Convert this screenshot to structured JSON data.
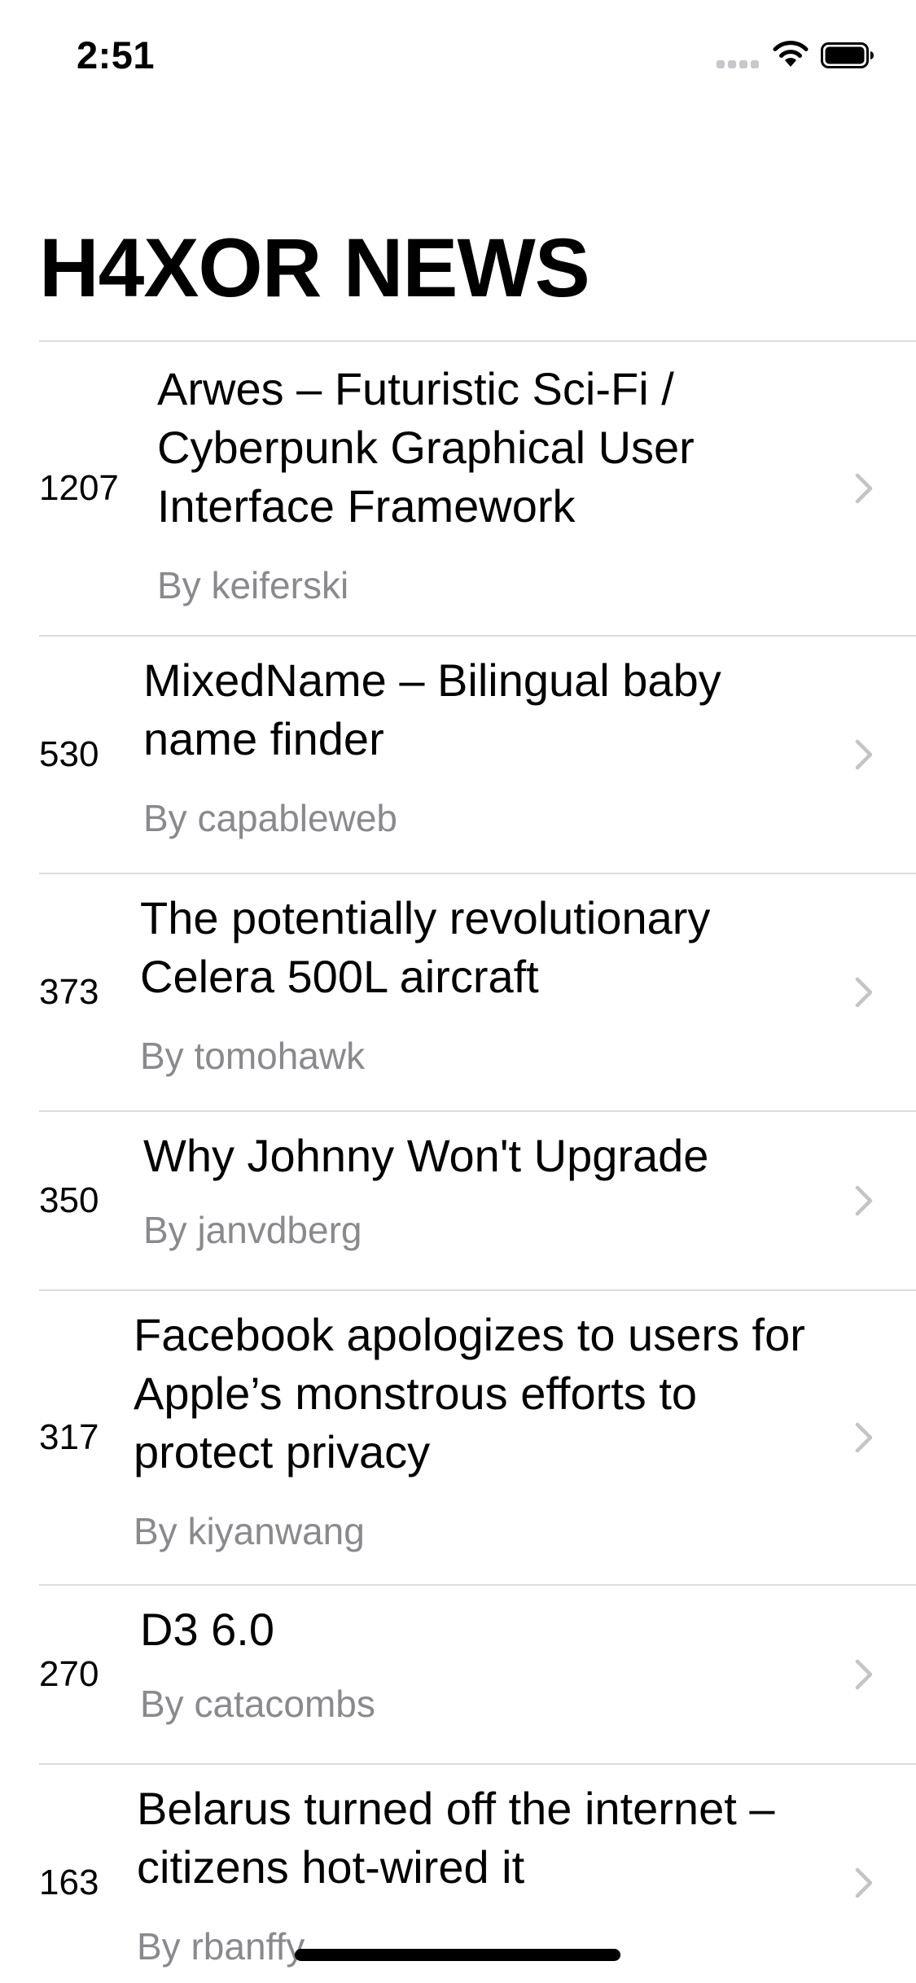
{
  "status_bar": {
    "time": "2:51"
  },
  "page": {
    "title": "H4XOR NEWS"
  },
  "stories": [
    {
      "points": "1207",
      "title_lines": [
        "Arwes – Futuristic Sci-Fi /",
        "Cyberpunk Graphical User",
        "Interface Framework"
      ],
      "author": "By keiferski"
    },
    {
      "points": "530",
      "title_lines": [
        "MixedName – Bilingual baby",
        "name finder"
      ],
      "author": "By capableweb"
    },
    {
      "points": "373",
      "title_lines": [
        "The potentially revolutionary",
        "Celera 500L aircraft"
      ],
      "author": "By tomohawk"
    },
    {
      "points": "350",
      "title_lines": [
        "Why Johnny Won't Upgrade"
      ],
      "author": "By janvdberg"
    },
    {
      "points": "317",
      "title_lines": [
        "Facebook apologizes to users for",
        "Apple’s monstrous efforts to",
        "protect privacy"
      ],
      "author": "By kiyanwang"
    },
    {
      "points": "270",
      "title_lines": [
        "D3 6.0"
      ],
      "author": "By catacombs"
    },
    {
      "points": "163",
      "title_lines": [
        "Belarus turned off the internet –",
        "citizens hot-wired it"
      ],
      "author": "By rbanffy"
    }
  ],
  "icons": {
    "row_accessory": "chevron-right-icon",
    "wifi": "wifi-icon",
    "battery": "battery-icon",
    "signal": "cellular-signal-icon"
  },
  "colors": {
    "background": "#ffffff",
    "text": "#000000",
    "secondary_text": "#8a8a8e",
    "separator": "#dcdce0",
    "chevron": "#c4c4c7"
  }
}
